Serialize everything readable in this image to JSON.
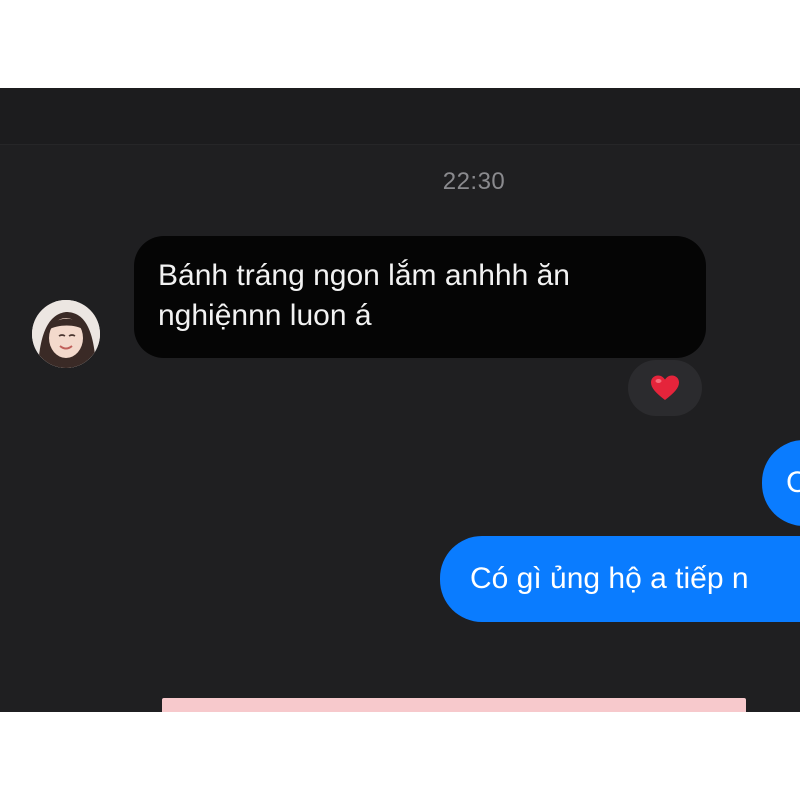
{
  "conversation": {
    "timestamp": "22:30",
    "incoming": {
      "lines": [
        "Bánh tráng ngon lắm anhhh ăn",
        "nghiệnnn luon á"
      ],
      "reaction": "heart-emoji",
      "reaction_color": "#e5243b"
    },
    "outgoing": [
      {
        "text": "C"
      },
      {
        "text": "Có gì ủng hộ a tiếp n"
      }
    ]
  },
  "colors": {
    "background": "#1f1f21",
    "incoming_bubble": "#050505",
    "outgoing_bubble": "#0a7cff",
    "timestamp": "#8a8a8e",
    "pink_card": "#f7c9cc"
  }
}
